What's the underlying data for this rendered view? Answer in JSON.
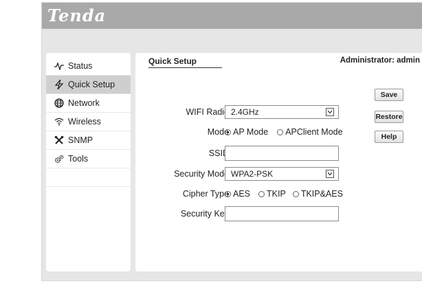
{
  "brand": {
    "logo_text": "Tenda"
  },
  "sidebar": {
    "items": [
      {
        "label": "Status",
        "icon": "pulse-icon",
        "active": false
      },
      {
        "label": "Quick Setup",
        "icon": "lightning-icon",
        "active": true
      },
      {
        "label": "Network",
        "icon": "globe-icon",
        "active": false
      },
      {
        "label": "Wireless",
        "icon": "wifi-icon",
        "active": false
      },
      {
        "label": "SNMP",
        "icon": "tools-cross-icon",
        "active": false
      },
      {
        "label": "Tools",
        "icon": "gears-icon",
        "active": false
      }
    ]
  },
  "header": {
    "tab_label": "Quick Setup",
    "admin_prefix": "Administrator:",
    "admin_user": "admin"
  },
  "form": {
    "wifi_radio": {
      "label": "WIFI Radio",
      "value": "2.4GHz"
    },
    "mode": {
      "label": "Mode",
      "options": [
        "AP Mode",
        "APClient Mode"
      ],
      "selected": "AP Mode"
    },
    "ssid": {
      "label": "SSID",
      "value": ""
    },
    "security_mode": {
      "label": "Security Mode",
      "value": "WPA2-PSK"
    },
    "cipher_type": {
      "label": "Cipher Type",
      "options": [
        "AES",
        "TKIP",
        "TKIP&AES"
      ],
      "selected": "AES"
    },
    "security_key": {
      "label": "Security Key",
      "value": ""
    }
  },
  "buttons": {
    "save": "Save",
    "restore": "Restore",
    "help": "Help"
  },
  "colors": {
    "topbar": "#a9a9a9",
    "background": "#e6e6e6",
    "active_nav": "#cfcfcf"
  }
}
